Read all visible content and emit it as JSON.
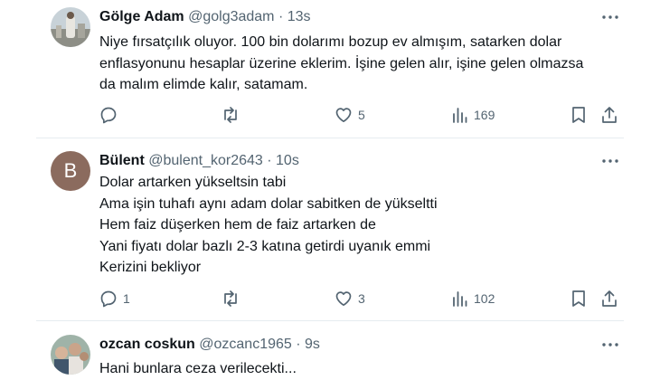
{
  "tweets": [
    {
      "name": "Gölge Adam",
      "handle": "@golg3adam",
      "separator": "·",
      "time": "13s",
      "lines": [
        "Niye fırsatçılık oluyor. 100 bin dolarımı bozup ev almışım, satarken dolar",
        "enflasyonunu hesaplar üzerine eklerim. İşine gelen alır, işine gelen olmazsa",
        "da malım elimde kalır, satamam."
      ],
      "replies": "",
      "retweets": "",
      "likes": "5",
      "views": "169"
    },
    {
      "name": "Bülent",
      "handle": "@bulent_kor2643",
      "separator": "·",
      "time": "10s",
      "avatar_letter": "B",
      "lines": [
        "Dolar artarken yükseltsin tabi",
        "Ama işin tuhafı aynı adam dolar sabitken de yükseltti",
        "Hem faiz düşerken hem de faiz artarken de",
        "Yani fiyatı dolar bazlı 2-3 katına getirdi uyanık emmi",
        "Kerizini bekliyor"
      ],
      "replies": "1",
      "retweets": "",
      "likes": "3",
      "views": "102"
    },
    {
      "name": "ozcan coskun",
      "handle": "@ozcanc1965",
      "separator": "·",
      "time": "9s",
      "lines": [
        "Hani bunlara ceza verilecekti..."
      ]
    }
  ],
  "colors": {
    "text": "#0f1419",
    "secondary": "#536471",
    "divider": "#e6ecf0",
    "avatar_b": "#8b6b5e"
  },
  "icons": [
    "more-icon",
    "reply-icon",
    "retweet-icon",
    "like-icon",
    "views-icon",
    "bookmark-icon",
    "share-icon"
  ]
}
